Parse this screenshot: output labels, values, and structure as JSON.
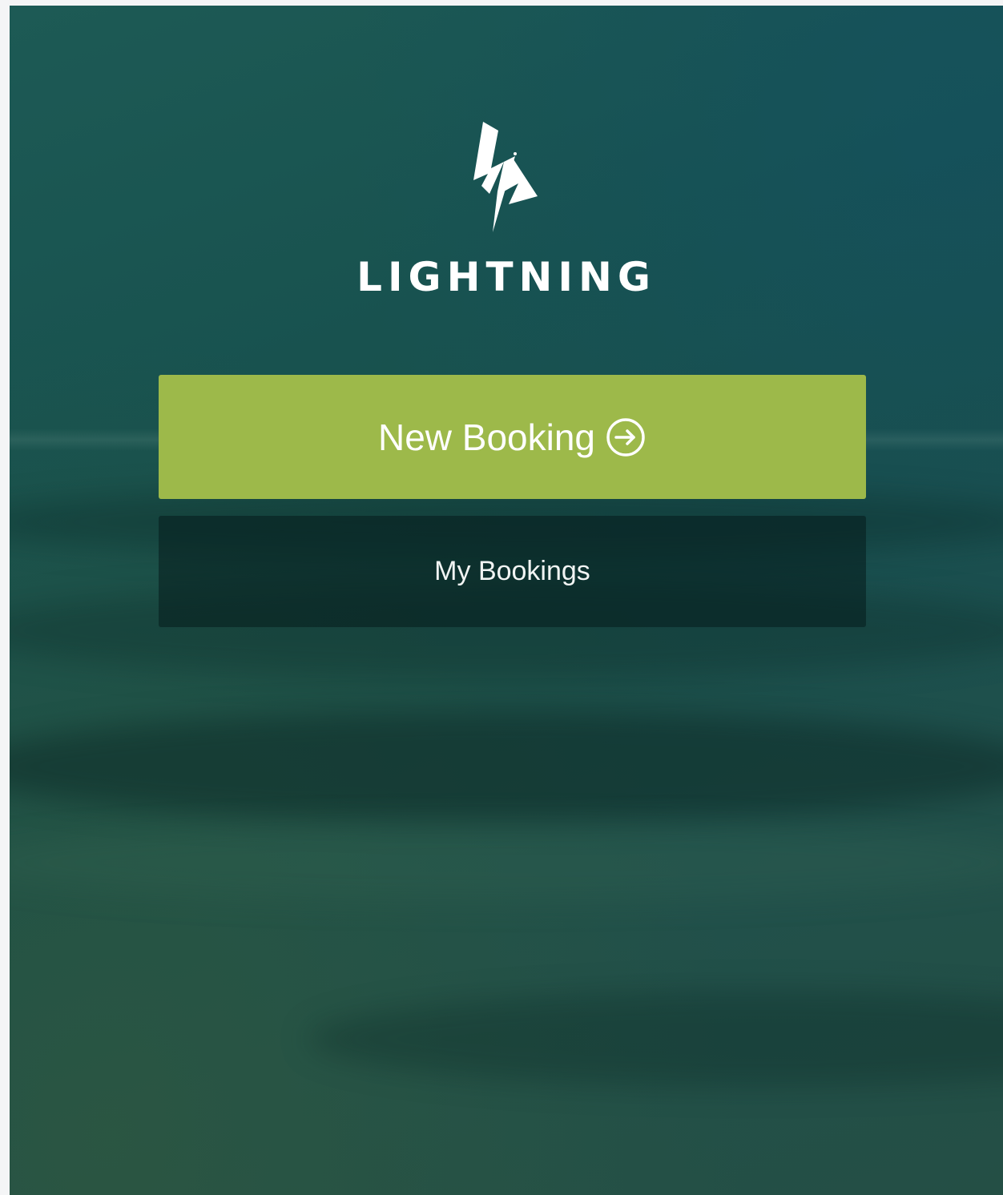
{
  "brand": {
    "name": "LIGHTNING",
    "logo_icon": "lightning-bolt-logo-icon"
  },
  "actions": {
    "new_booking_label": "New Booking",
    "new_booking_icon": "arrow-right-circle-icon",
    "my_bookings_label": "My Bookings"
  },
  "colors": {
    "primary_button": "#9db94a",
    "secondary_button": "rgba(5,28,28,0.55)",
    "background": "#1a4f4a",
    "text": "#ffffff"
  }
}
